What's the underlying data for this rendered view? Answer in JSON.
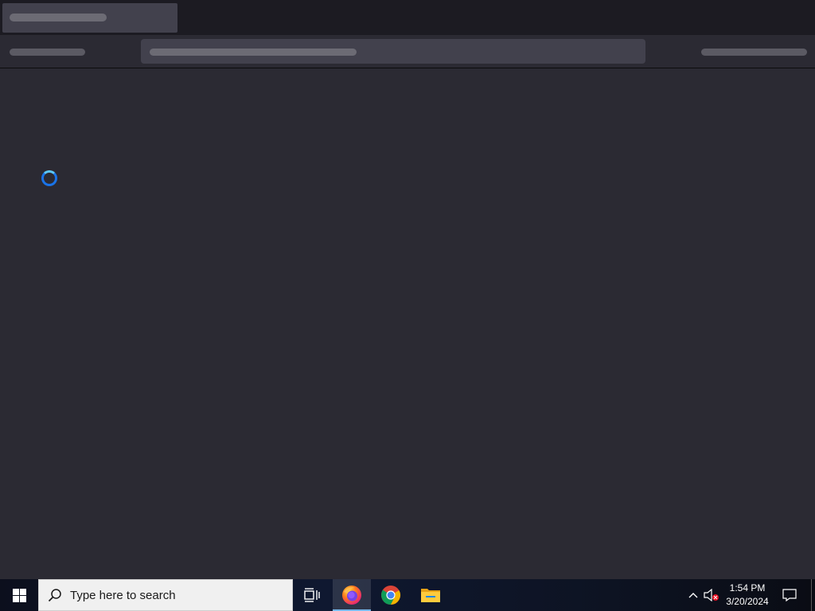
{
  "taskbar": {
    "search_placeholder": "Type here to search",
    "pinned": [
      {
        "name": "task-view-icon"
      },
      {
        "name": "firefox-icon",
        "active": true
      },
      {
        "name": "chrome-icon"
      },
      {
        "name": "file-explorer-icon"
      }
    ],
    "clock": {
      "time": "1:54 PM",
      "date": "3/20/2024"
    }
  },
  "browser": {
    "state": "loading",
    "colors": {
      "chrome_bg": "#1c1b22",
      "toolbar_bg": "#2b2a33",
      "skeleton": "#42414d",
      "spinner": "#1a73e8"
    }
  }
}
